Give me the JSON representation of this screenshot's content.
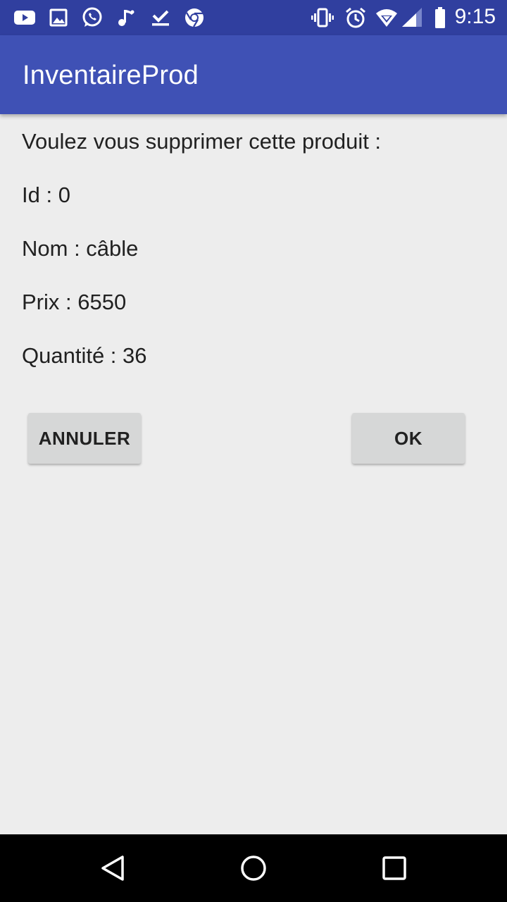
{
  "status_bar": {
    "time": "9:15",
    "left_icons": [
      "youtube-icon",
      "gallery-icon",
      "whatsapp-icon",
      "music-note-icon",
      "download-done-icon",
      "chrome-icon"
    ],
    "right_icons": [
      "vibrate-icon",
      "alarm-icon",
      "wifi-icon",
      "signal-icon",
      "battery-icon"
    ]
  },
  "app_bar": {
    "title": "InventaireProd"
  },
  "dialog": {
    "question": "Voulez vous supprimer cette produit :",
    "id_line": "Id : 0",
    "name_line": "Nom : câble",
    "price_line": "Prix : 6550",
    "quantity_line": "Quantité : 36"
  },
  "buttons": {
    "cancel_label": "ANNULER",
    "ok_label": "OK"
  },
  "nav_bar": {
    "icons": [
      "back-icon",
      "home-icon",
      "recents-icon"
    ]
  },
  "colors": {
    "status_bar": "#303f9f",
    "app_bar": "#3f51b5",
    "background": "#ededed",
    "button": "#d6d7d7"
  }
}
